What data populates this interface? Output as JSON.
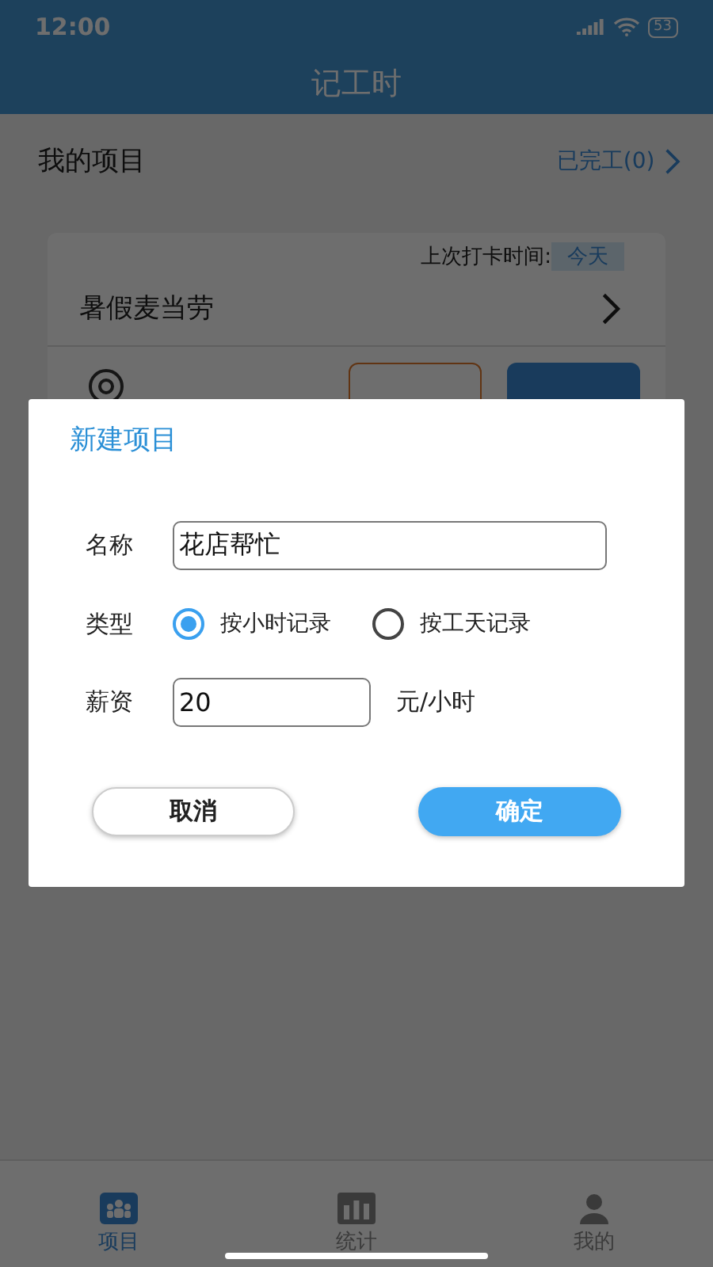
{
  "status_bar": {
    "time": "12:00",
    "battery": "53"
  },
  "header": {
    "title": "记工时"
  },
  "section": {
    "title": "我的项目",
    "finished_link": "已完工(0)"
  },
  "project_card": {
    "last_label": "上次打卡时间:",
    "last_value": "今天",
    "name": "暑假麦当劳"
  },
  "dialog": {
    "title": "新建项目",
    "name_field": {
      "label": "名称",
      "value": "花店帮忙"
    },
    "type_field": {
      "label": "类型",
      "options": [
        {
          "label": "按小时记录",
          "selected": true
        },
        {
          "label": "按工天记录",
          "selected": false
        }
      ]
    },
    "wage_field": {
      "label": "薪资",
      "value": "20",
      "unit": "元/小时"
    },
    "buttons": [
      {
        "label": "取消",
        "kind": "secondary"
      },
      {
        "label": "确定",
        "kind": "primary"
      }
    ]
  },
  "tab_bar": [
    {
      "label": "项目",
      "selected": true
    },
    {
      "label": "统计",
      "selected": false
    },
    {
      "label": "我的",
      "selected": false
    }
  ]
}
